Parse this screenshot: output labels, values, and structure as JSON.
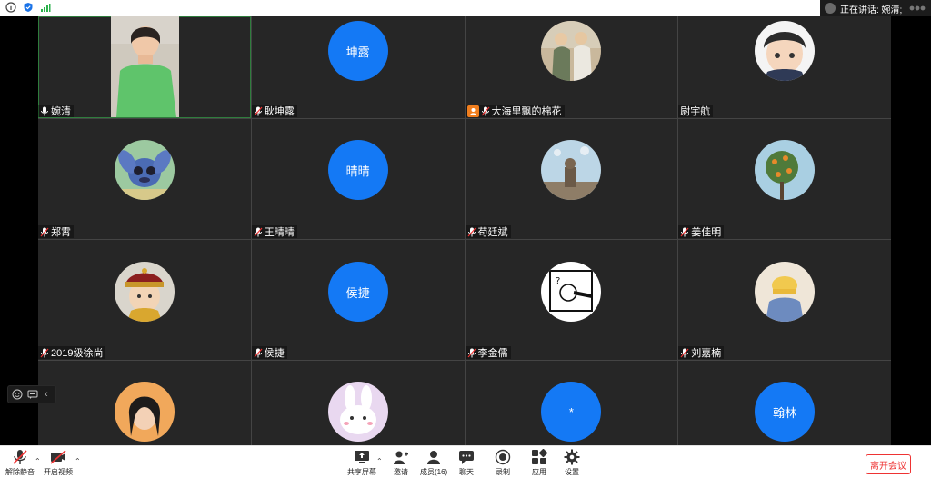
{
  "topbar": {
    "speaking_label": "正在讲话: 婉清;"
  },
  "participants": [
    {
      "name": "婉清",
      "avatar_type": "video",
      "mic": "on",
      "active": true
    },
    {
      "name": "耿坤露",
      "avatar_type": "text",
      "avatar_text": "坤露",
      "mic": "muted"
    },
    {
      "name": "大海里飘的棉花",
      "avatar_type": "photo",
      "photo": "two-people",
      "mic": "muted",
      "host": true
    },
    {
      "name": "尉宇航",
      "avatar_type": "photo",
      "photo": "anime-boy",
      "mic": "none"
    },
    {
      "name": "郑霄",
      "avatar_type": "photo",
      "photo": "stitch",
      "mic": "muted"
    },
    {
      "name": "王晴晴",
      "avatar_type": "text",
      "avatar_text": "晴晴",
      "mic": "muted"
    },
    {
      "name": "苟廷斌",
      "avatar_type": "photo",
      "photo": "statue-sky",
      "mic": "muted"
    },
    {
      "name": "姜佳明",
      "avatar_type": "photo",
      "photo": "orange-tree",
      "mic": "muted"
    },
    {
      "name": "2019级徐尚",
      "avatar_type": "photo",
      "photo": "cartoon-emperor",
      "mic": "muted"
    },
    {
      "name": "侯捷",
      "avatar_type": "text",
      "avatar_text": "侯捷",
      "mic": "muted"
    },
    {
      "name": "李金儒",
      "avatar_type": "photo",
      "photo": "sketch-question",
      "mic": "muted"
    },
    {
      "name": "刘嘉楠",
      "avatar_type": "photo",
      "photo": "girl-hat",
      "mic": "muted"
    },
    {
      "name": "",
      "avatar_type": "photo",
      "photo": "girl-portrait",
      "mic": "none"
    },
    {
      "name": "",
      "avatar_type": "photo",
      "photo": "bunny",
      "mic": "none"
    },
    {
      "name": "",
      "avatar_type": "text",
      "avatar_text": "*",
      "mic": "none"
    },
    {
      "name": "",
      "avatar_type": "text",
      "avatar_text": "翰林",
      "mic": "none"
    }
  ],
  "toolbar": {
    "unmute": "解除静音",
    "start_video": "开启视频",
    "share_screen": "共享屏幕",
    "invite": "邀请",
    "members": "成员(16)",
    "chat": "聊天",
    "record": "录制",
    "apps": "应用",
    "settings": "设置",
    "leave": "离开会议"
  },
  "colors": {
    "avatar_blue": "#1479f5",
    "tile_bg": "#262626",
    "leave_red": "#e33333",
    "host_orange": "#f07e1e"
  }
}
